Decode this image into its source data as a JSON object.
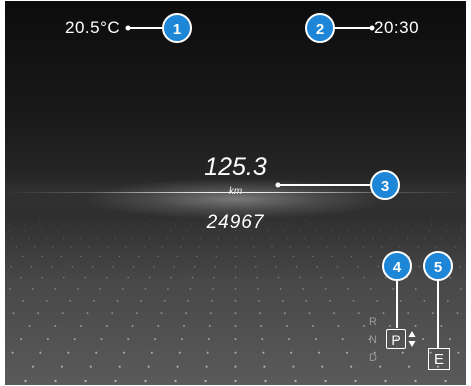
{
  "status_bar": {
    "outside_temperature": "20.5°C",
    "clock": "20:30"
  },
  "trip_display": {
    "trip_distance": "125.3",
    "distance_unit": "km",
    "total_distance": "24967"
  },
  "transmission": {
    "gears": [
      "R",
      "N",
      "D"
    ],
    "selected_gear": "P"
  },
  "drive_program": {
    "mode": "E"
  },
  "callouts": [
    "1",
    "2",
    "3",
    "4",
    "5"
  ],
  "colors": {
    "callout_fill": "#1e86d6",
    "callout_stroke": "#ffffff",
    "text": "#ffffff",
    "inactive_gear": "#9a9a9a"
  }
}
